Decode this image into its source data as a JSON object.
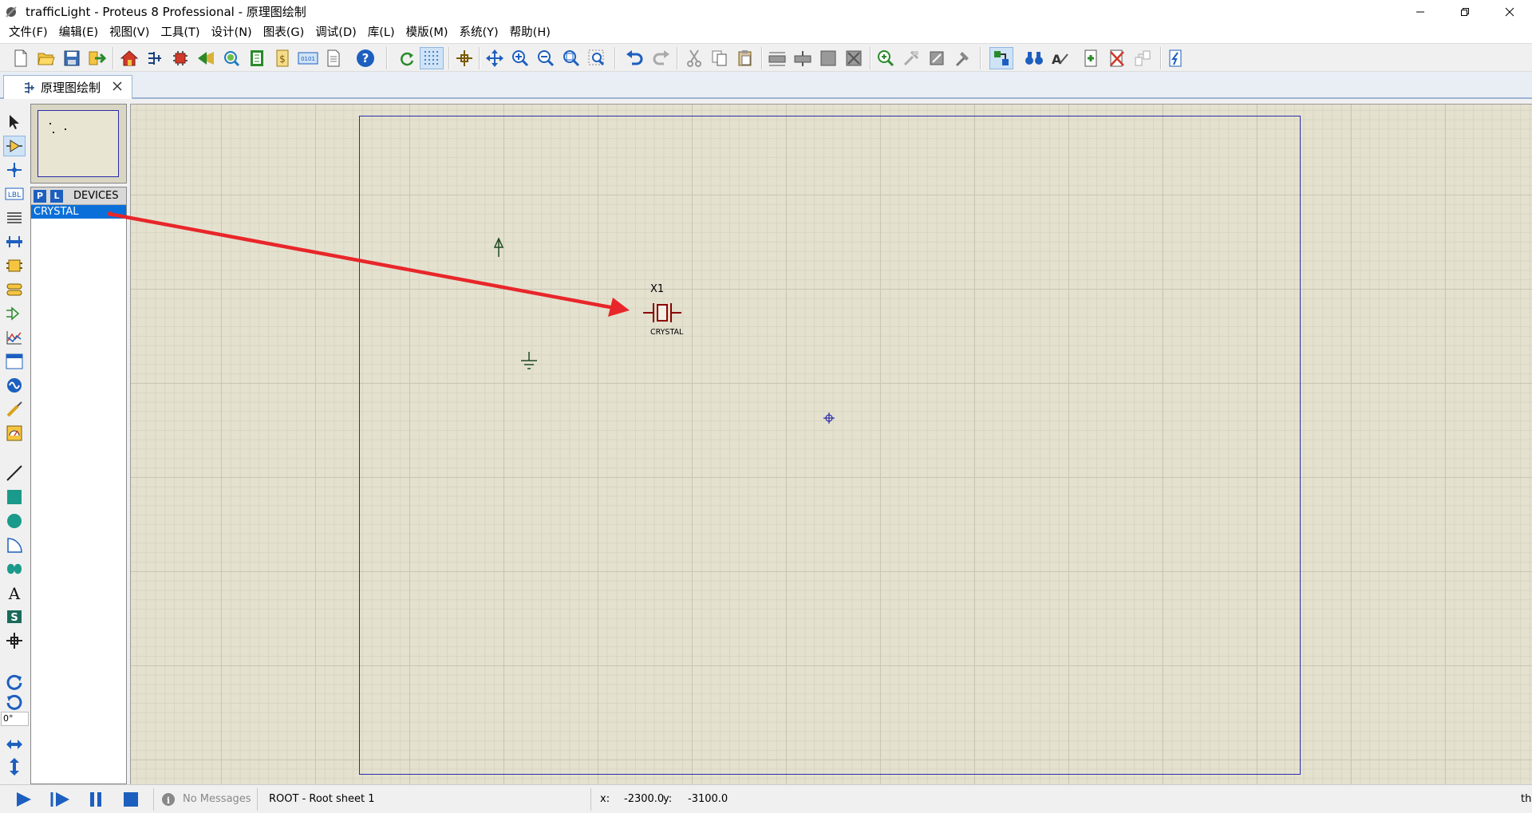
{
  "window": {
    "title": "trafficLight - Proteus 8 Professional - 原理图绘制"
  },
  "menu": [
    "文件(F)",
    "编辑(E)",
    "视图(V)",
    "工具(T)",
    "设计(N)",
    "图表(G)",
    "调试(D)",
    "库(L)",
    "模版(M)",
    "系统(Y)",
    "帮助(H)"
  ],
  "tab": {
    "label": "原理图绘制"
  },
  "device_panel": {
    "p_label": "P",
    "l_label": "L",
    "title": "DEVICES",
    "items": [
      "CRYSTAL"
    ]
  },
  "rotation": "0°",
  "canvas": {
    "component_ref": "X1",
    "component_value": "CRYSTAL"
  },
  "status": {
    "messages": "No Messages",
    "sheet": "ROOT - Root sheet 1",
    "x_label": "x:",
    "x_value": "-2300.0",
    "y_label": "y:",
    "y_value": "-3100.0",
    "units": "th"
  },
  "colors": {
    "canvas_bg": "#e4e1cf",
    "sheet_border": "#2c2ca8",
    "component": "#8b0000",
    "annotation_arrow": "#e8262a",
    "selection": "#0b6fd9"
  }
}
